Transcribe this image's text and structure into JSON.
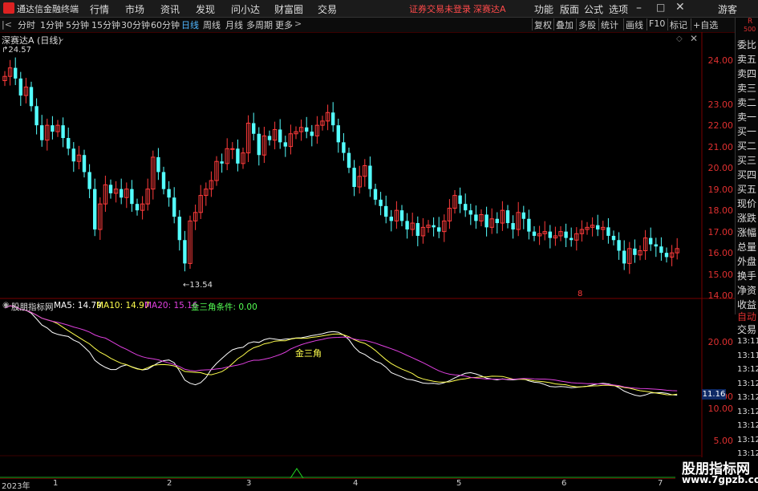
{
  "app": {
    "title": "通达信金融终端"
  },
  "menu": [
    "行情",
    "市场",
    "资讯",
    "发现",
    "问小达",
    "财富圈",
    "交易"
  ],
  "warning": "证券交易未登录",
  "stock_name": "深赛达A",
  "right_menu": [
    "功能",
    "版面",
    "公式",
    "选项"
  ],
  "guest": "游客",
  "tabs": [
    "分时",
    "1分钟",
    "5分钟",
    "15分钟",
    "30分钟",
    "60分钟",
    "日线",
    "周线",
    "月线",
    "多周期",
    "更多"
  ],
  "active_tab": "日线",
  "toolbar": [
    "复权",
    "叠加",
    "多股",
    "统计",
    "画线",
    "F10",
    "标记",
    "+自选"
  ],
  "chart_title": "深赛达A (日线)",
  "price_axis": [
    "24.00",
    "23.00",
    "22.00",
    "21.00",
    "20.00",
    "19.00",
    "18.00",
    "17.00",
    "16.00",
    "15.00",
    "14.00"
  ],
  "high_label": "24.57",
  "low_label": "13.54",
  "marker_8": "8",
  "indicator": {
    "name": "股朋指标网",
    "ma5": "MA5: 14.79",
    "ma10": "MA10: 14.97",
    "ma20": "MA20: 15.16",
    "cond": "金三角条件: 0.00",
    "annotation": "金三角",
    "axis": [
      "20.00",
      "15.00",
      "10.00",
      "5.00"
    ],
    "current": "11.16"
  },
  "side_items": [
    "委比",
    "卖五",
    "卖四",
    "卖三",
    "卖二",
    "卖一",
    "买一",
    "买二",
    "买三",
    "买四",
    "买五",
    "现价",
    "涨跌",
    "涨幅",
    "总量",
    "外盘",
    "换手",
    "净资",
    "收益"
  ],
  "side_r": "R",
  "side_500": "500",
  "side_buttons": [
    "自动",
    "交易"
  ],
  "side_times": [
    "13:11",
    "13:11",
    "13:12",
    "13:12",
    "13:12",
    "13:12",
    "13:12",
    "13:12",
    "13:12",
    "13:12"
  ],
  "dates": [
    "2023年",
    "1",
    "2",
    "3",
    "4",
    "5",
    "6",
    "7"
  ],
  "watermark": {
    "line1": "股朋指标网",
    "line2": "www.7gpzb.com"
  },
  "colors": {
    "up": "#ff3b3b",
    "down": "#54ffff",
    "ma5": "#ffffff",
    "ma10": "#ffff4d",
    "ma20": "#e040e0",
    "axis": "#e03030"
  },
  "chart_data": {
    "type": "candlestick",
    "closes": [
      23.2,
      23.6,
      23.1,
      22.3,
      22.7,
      21.8,
      20.9,
      20.2,
      20.9,
      20.6,
      20.9,
      20.3,
      19.8,
      19.2,
      19.5,
      18.7,
      17.9,
      16.0,
      17.2,
      18.1,
      17.7,
      17.9,
      17.5,
      17.9,
      17.2,
      16.9,
      17.2,
      17.9,
      19.4,
      18.7,
      17.9,
      17.5,
      16.6,
      15.5,
      14.4,
      16.4,
      16.8,
      17.6,
      17.9,
      18.3,
      19.2,
      19.1,
      19.8,
      19.8,
      19.1,
      19.6,
      21.0,
      20.5,
      19.5,
      20.4,
      20.2,
      20.7,
      20.1,
      19.9,
      20.5,
      20.6,
      20.8,
      20.6,
      20.4,
      20.9,
      21.1,
      21.5,
      20.9,
      20.1,
      19.6,
      18.9,
      18.0,
      18.5,
      19.0,
      17.9,
      17.4,
      17.1,
      16.6,
      16.4,
      16.9,
      16.4,
      16.0,
      16.3,
      15.7,
      16.1,
      16.2,
      16.1,
      15.9,
      16.4,
      17.0,
      17.6,
      17.2,
      16.9,
      16.7,
      16.4,
      16.7,
      16.1,
      16.5,
      16.3,
      16.9,
      16.3,
      16.0,
      16.8,
      16.5,
      15.9,
      15.7,
      15.8,
      15.9,
      15.6,
      15.7,
      15.9,
      15.6,
      15.5,
      15.8,
      16.0,
      16.1,
      16.2,
      16.0,
      16.1,
      15.7,
      15.5,
      15.0,
      14.4,
      15.1,
      14.8,
      15.0,
      15.6,
      15.3,
      15.2,
      14.9,
      14.7,
      14.9,
      15.1
    ]
  }
}
